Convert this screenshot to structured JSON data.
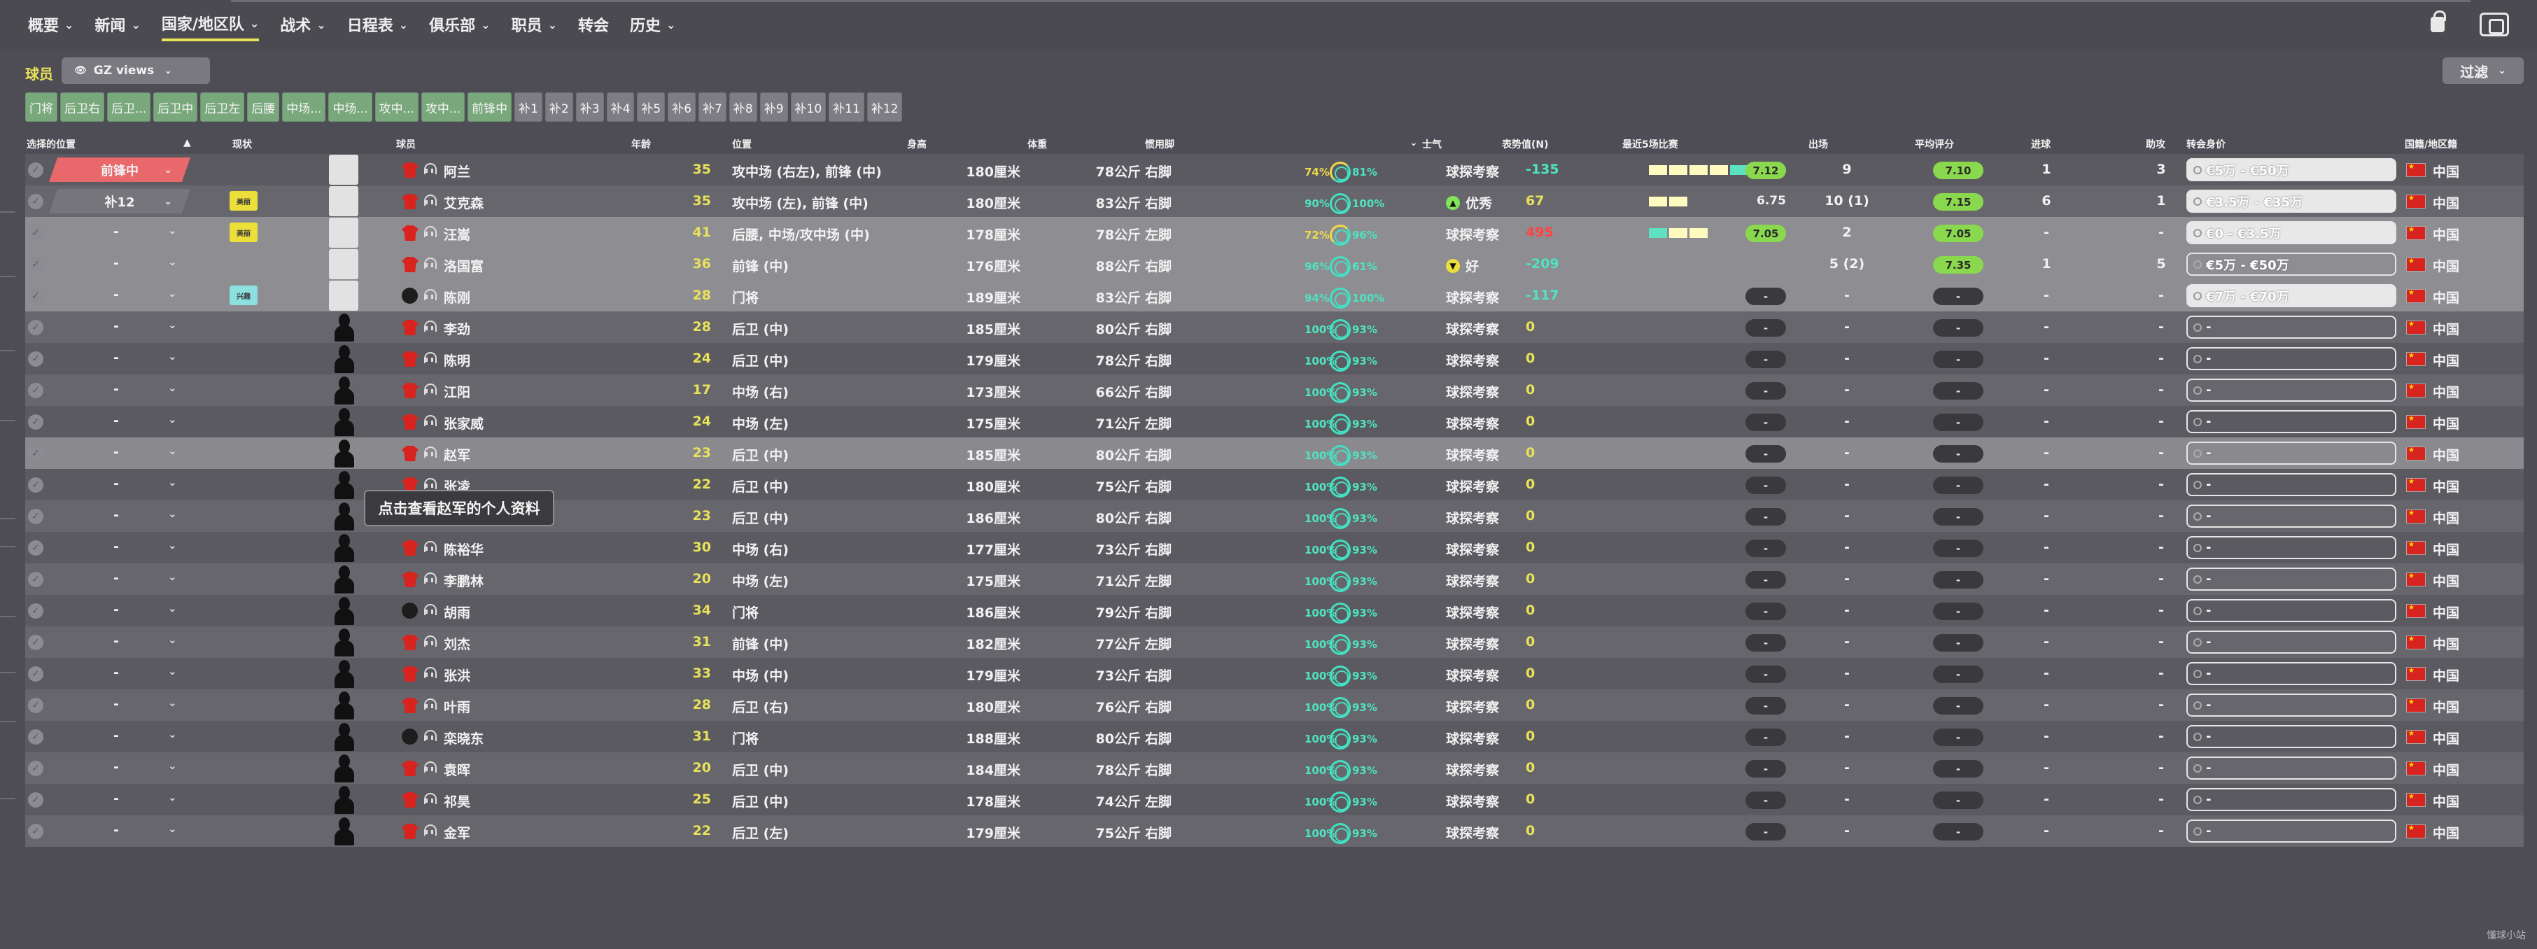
{
  "nav": {
    "items": [
      {
        "label": "概要",
        "chevron": true
      },
      {
        "label": "新闻",
        "chevron": true
      },
      {
        "label": "国家/地区队",
        "chevron": true,
        "active": true
      },
      {
        "label": "战术",
        "chevron": true
      },
      {
        "label": "日程表",
        "chevron": true
      },
      {
        "label": "俱乐部",
        "chevron": true
      },
      {
        "label": "职员",
        "chevron": true
      },
      {
        "label": "转会",
        "chevron": false
      },
      {
        "label": "历史",
        "chevron": true
      }
    ]
  },
  "section": {
    "label": "球员",
    "views_label": "GZ views",
    "filter_label": "过滤"
  },
  "chips": [
    "门将",
    "后卫右",
    "后卫...",
    "后卫中",
    "后卫左",
    "后腰",
    "中场...",
    "中场...",
    "攻中...",
    "攻中...",
    "前锋中",
    "补1",
    "补2",
    "补3",
    "补4",
    "补5",
    "补6",
    "补7",
    "补8",
    "补9",
    "补10",
    "补11",
    "补12"
  ],
  "columns": {
    "selected_position": "选择的位置",
    "status": "现状",
    "player": "球员",
    "age": "年龄",
    "position": "位置",
    "height": "身高",
    "weight": "体重",
    "foot": "惯用脚",
    "morale": "士气",
    "sell": "表势值(N)",
    "form": "最近5场比赛",
    "apps": "出场",
    "avg": "平均评分",
    "goals": "进球",
    "assists": "助攻",
    "value": "转会身价",
    "nation": "国籍/地区籍"
  },
  "tooltip": "点击查看赵军的个人资料",
  "watermark": "懂球小站",
  "players": [
    {
      "sel": "前锋中",
      "sel_style": "red",
      "status": "",
      "avatar": "photo",
      "kit": "shirt",
      "name": "阿兰",
      "age": "35",
      "position": "攻中场 (右左), 前锋 (中)",
      "height": "180厘米",
      "weight": "78公斤",
      "foot": "右脚",
      "c1": "74%",
      "c2": "81%",
      "cy": true,
      "morale": "球探考察",
      "micon": "",
      "sell": "-135",
      "sellc": "g",
      "form": [
        "y",
        "y",
        "y",
        "y",
        "t"
      ],
      "rating": "7.12",
      "rstyle": "g",
      "apps": "9",
      "avg": "7.10",
      "avgstyle": "g",
      "goals": "1",
      "assists": "3",
      "value": "€5万 - €50万",
      "vfill": true,
      "nation": "中国"
    },
    {
      "sel": "补12",
      "sel_style": "gray",
      "status": "美丽",
      "avatar": "photo",
      "kit": "shirt",
      "name": "艾克森",
      "age": "35",
      "position": "攻中场 (左), 前锋 (中)",
      "height": "180厘米",
      "weight": "83公斤",
      "foot": "右脚",
      "c1": "90%",
      "c2": "100%",
      "cy": false,
      "morale": "优秀",
      "micon": "g",
      "sell": "67",
      "sellc": "y",
      "form": [
        "y",
        "y"
      ],
      "rating": "6.75",
      "rstyle": "t",
      "apps": "10 (1)",
      "avg": "7.15",
      "avgstyle": "g",
      "goals": "6",
      "assists": "1",
      "value": "€3.5万 - €35万",
      "vfill": true,
      "nation": "中国"
    },
    {
      "sel": "-",
      "sel_style": "",
      "status": "美丽",
      "avatar": "photo",
      "kit": "shirt",
      "name": "汪嵩",
      "age": "41",
      "position": "后腰, 中场/攻中场 (中)",
      "height": "178厘米",
      "weight": "78公斤",
      "foot": "左脚",
      "c1": "72%",
      "c2": "96%",
      "cy": true,
      "morale": "球探考察",
      "micon": "",
      "sell": "495",
      "sellc": "r",
      "form": [
        "t",
        "y",
        "y"
      ],
      "rating": "7.05",
      "rstyle": "g",
      "apps": "2",
      "avg": "7.05",
      "avgstyle": "g",
      "goals": "-",
      "assists": "-",
      "value": "€0 - €3.5万",
      "vfill": true,
      "nation": "中国"
    },
    {
      "sel": "-",
      "sel_style": "",
      "status": "",
      "avatar": "photo",
      "kit": "shirt",
      "name": "洛国富",
      "age": "36",
      "position": "前锋 (中)",
      "height": "176厘米",
      "weight": "88公斤",
      "foot": "右脚",
      "c1": "96%",
      "c2": "61%",
      "cy": false,
      "morale": "好",
      "micon": "y",
      "sell": "-209",
      "sellc": "g",
      "form": [],
      "rating": "",
      "rstyle": "",
      "apps": "5 (2)",
      "avg": "7.35",
      "avgstyle": "g",
      "goals": "1",
      "assists": "5",
      "value": "€5万 - €50万",
      "vfill": false,
      "nation": "中国"
    },
    {
      "sel": "-",
      "sel_style": "",
      "status": "兴趣",
      "avatar": "photo",
      "kit": "ball",
      "name": "陈刚",
      "age": "28",
      "position": "门将",
      "height": "189厘米",
      "weight": "83公斤",
      "foot": "右脚",
      "c1": "94%",
      "c2": "100%",
      "cy": false,
      "morale": "球探考察",
      "micon": "",
      "sell": "-117",
      "sellc": "g",
      "form": [],
      "rating": "-",
      "rstyle": "n",
      "apps": "-",
      "avg": "-",
      "avgstyle": "n",
      "goals": "-",
      "assists": "-",
      "value": "€7万 - €70万",
      "vfill": true,
      "nation": "中国"
    },
    {
      "sel": "-",
      "sel_style": "",
      "status": "",
      "avatar": "sil",
      "kit": "shirt",
      "name": "李劲",
      "age": "28",
      "position": "后卫 (中)",
      "height": "185厘米",
      "weight": "80公斤",
      "foot": "右脚",
      "c1": "100%",
      "c2": "93%",
      "cy": false,
      "morale": "球探考察",
      "micon": "",
      "sell": "0",
      "sellc": "y",
      "form": [],
      "rating": "-",
      "rstyle": "n",
      "apps": "-",
      "avg": "-",
      "avgstyle": "n",
      "goals": "-",
      "assists": "-",
      "value": "-",
      "vfill": false,
      "nation": "中国"
    },
    {
      "sel": "-",
      "sel_style": "",
      "status": "",
      "avatar": "sil",
      "kit": "shirt",
      "name": "陈明",
      "age": "24",
      "position": "后卫 (中)",
      "height": "179厘米",
      "weight": "78公斤",
      "foot": "右脚",
      "c1": "100%",
      "c2": "93%",
      "cy": false,
      "morale": "球探考察",
      "micon": "",
      "sell": "0",
      "sellc": "y",
      "form": [],
      "rating": "-",
      "rstyle": "n",
      "apps": "-",
      "avg": "-",
      "avgstyle": "n",
      "goals": "-",
      "assists": "-",
      "value": "-",
      "vfill": false,
      "nation": "中国"
    },
    {
      "sel": "-",
      "sel_style": "",
      "status": "",
      "avatar": "sil",
      "kit": "shirt",
      "name": "江阳",
      "age": "17",
      "position": "中场 (右)",
      "height": "173厘米",
      "weight": "66公斤",
      "foot": "右脚",
      "c1": "100%",
      "c2": "93%",
      "cy": false,
      "morale": "球探考察",
      "micon": "",
      "sell": "0",
      "sellc": "y",
      "form": [],
      "rating": "-",
      "rstyle": "n",
      "apps": "-",
      "avg": "-",
      "avgstyle": "n",
      "goals": "-",
      "assists": "-",
      "value": "-",
      "vfill": false,
      "nation": "中国"
    },
    {
      "sel": "-",
      "sel_style": "",
      "status": "",
      "avatar": "sil",
      "kit": "shirt",
      "name": "张家威",
      "age": "24",
      "position": "中场 (左)",
      "height": "175厘米",
      "weight": "71公斤",
      "foot": "左脚",
      "c1": "100%",
      "c2": "93%",
      "cy": false,
      "morale": "球探考察",
      "micon": "",
      "sell": "0",
      "sellc": "y",
      "form": [],
      "rating": "-",
      "rstyle": "n",
      "apps": "-",
      "avg": "-",
      "avgstyle": "n",
      "goals": "-",
      "assists": "-",
      "value": "-",
      "vfill": false,
      "nation": "中国"
    },
    {
      "sel": "-",
      "sel_style": "",
      "status": "",
      "avatar": "sil",
      "kit": "shirt",
      "name": "赵军",
      "age": "23",
      "position": "后卫 (中)",
      "height": "185厘米",
      "weight": "80公斤",
      "foot": "右脚",
      "c1": "100%",
      "c2": "93%",
      "cy": false,
      "morale": "球探考察",
      "micon": "",
      "sell": "0",
      "sellc": "y",
      "form": [],
      "rating": "-",
      "rstyle": "n",
      "apps": "-",
      "avg": "-",
      "avgstyle": "n",
      "goals": "-",
      "assists": "-",
      "value": "-",
      "vfill": false,
      "nation": "中国"
    },
    {
      "sel": "-",
      "sel_style": "",
      "status": "",
      "avatar": "sil",
      "kit": "shirt",
      "name": "张凌",
      "age": "22",
      "position": "后卫 (中)",
      "height": "180厘米",
      "weight": "75公斤",
      "foot": "右脚",
      "c1": "100%",
      "c2": "93%",
      "cy": false,
      "morale": "球探考察",
      "micon": "",
      "sell": "0",
      "sellc": "y",
      "form": [],
      "rating": "-",
      "rstyle": "n",
      "apps": "-",
      "avg": "-",
      "avgstyle": "n",
      "goals": "-",
      "assists": "-",
      "value": "-",
      "vfill": false,
      "nation": "中国"
    },
    {
      "sel": "-",
      "sel_style": "",
      "status": "",
      "avatar": "sil",
      "kit": "shirt",
      "name": "",
      "age": "23",
      "position": "后卫 (中)",
      "height": "186厘米",
      "weight": "80公斤",
      "foot": "右脚",
      "c1": "100%",
      "c2": "93%",
      "cy": false,
      "morale": "球探考察",
      "micon": "",
      "sell": "0",
      "sellc": "y",
      "form": [],
      "rating": "-",
      "rstyle": "n",
      "apps": "-",
      "avg": "-",
      "avgstyle": "n",
      "goals": "-",
      "assists": "-",
      "value": "-",
      "vfill": false,
      "nation": "中国"
    },
    {
      "sel": "-",
      "sel_style": "",
      "status": "",
      "avatar": "sil",
      "kit": "shirt",
      "name": "陈裕华",
      "age": "30",
      "position": "中场 (右)",
      "height": "177厘米",
      "weight": "73公斤",
      "foot": "右脚",
      "c1": "100%",
      "c2": "93%",
      "cy": false,
      "morale": "球探考察",
      "micon": "",
      "sell": "0",
      "sellc": "y",
      "form": [],
      "rating": "-",
      "rstyle": "n",
      "apps": "-",
      "avg": "-",
      "avgstyle": "n",
      "goals": "-",
      "assists": "-",
      "value": "-",
      "vfill": false,
      "nation": "中国"
    },
    {
      "sel": "-",
      "sel_style": "",
      "status": "",
      "avatar": "sil",
      "kit": "shirt",
      "name": "李鹏林",
      "age": "20",
      "position": "中场 (左)",
      "height": "175厘米",
      "weight": "71公斤",
      "foot": "左脚",
      "c1": "100%",
      "c2": "93%",
      "cy": false,
      "morale": "球探考察",
      "micon": "",
      "sell": "0",
      "sellc": "y",
      "form": [],
      "rating": "-",
      "rstyle": "n",
      "apps": "-",
      "avg": "-",
      "avgstyle": "n",
      "goals": "-",
      "assists": "-",
      "value": "-",
      "vfill": false,
      "nation": "中国"
    },
    {
      "sel": "-",
      "sel_style": "",
      "status": "",
      "avatar": "sil",
      "kit": "ball",
      "name": "胡雨",
      "age": "34",
      "position": "门将",
      "height": "186厘米",
      "weight": "79公斤",
      "foot": "右脚",
      "c1": "100%",
      "c2": "93%",
      "cy": false,
      "morale": "球探考察",
      "micon": "",
      "sell": "0",
      "sellc": "y",
      "form": [],
      "rating": "-",
      "rstyle": "n",
      "apps": "-",
      "avg": "-",
      "avgstyle": "n",
      "goals": "-",
      "assists": "-",
      "value": "-",
      "vfill": false,
      "nation": "中国"
    },
    {
      "sel": "-",
      "sel_style": "",
      "status": "",
      "avatar": "sil",
      "kit": "shirt",
      "name": "刘杰",
      "age": "31",
      "position": "前锋 (中)",
      "height": "182厘米",
      "weight": "77公斤",
      "foot": "左脚",
      "c1": "100%",
      "c2": "93%",
      "cy": false,
      "morale": "球探考察",
      "micon": "",
      "sell": "0",
      "sellc": "y",
      "form": [],
      "rating": "-",
      "rstyle": "n",
      "apps": "-",
      "avg": "-",
      "avgstyle": "n",
      "goals": "-",
      "assists": "-",
      "value": "-",
      "vfill": false,
      "nation": "中国"
    },
    {
      "sel": "-",
      "sel_style": "",
      "status": "",
      "avatar": "sil",
      "kit": "shirt",
      "name": "张洪",
      "age": "33",
      "position": "中场 (中)",
      "height": "179厘米",
      "weight": "73公斤",
      "foot": "右脚",
      "c1": "100%",
      "c2": "93%",
      "cy": false,
      "morale": "球探考察",
      "micon": "",
      "sell": "0",
      "sellc": "y",
      "form": [],
      "rating": "-",
      "rstyle": "n",
      "apps": "-",
      "avg": "-",
      "avgstyle": "n",
      "goals": "-",
      "assists": "-",
      "value": "-",
      "vfill": false,
      "nation": "中国"
    },
    {
      "sel": "-",
      "sel_style": "",
      "status": "",
      "avatar": "sil",
      "kit": "shirt",
      "name": "叶雨",
      "age": "28",
      "position": "后卫 (右)",
      "height": "180厘米",
      "weight": "76公斤",
      "foot": "右脚",
      "c1": "100%",
      "c2": "93%",
      "cy": false,
      "morale": "球探考察",
      "micon": "",
      "sell": "0",
      "sellc": "y",
      "form": [],
      "rating": "-",
      "rstyle": "n",
      "apps": "-",
      "avg": "-",
      "avgstyle": "n",
      "goals": "-",
      "assists": "-",
      "value": "-",
      "vfill": false,
      "nation": "中国"
    },
    {
      "sel": "-",
      "sel_style": "",
      "status": "",
      "avatar": "sil",
      "kit": "ball",
      "name": "栾晓东",
      "age": "31",
      "position": "门将",
      "height": "188厘米",
      "weight": "80公斤",
      "foot": "右脚",
      "c1": "100%",
      "c2": "93%",
      "cy": false,
      "morale": "球探考察",
      "micon": "",
      "sell": "0",
      "sellc": "y",
      "form": [],
      "rating": "-",
      "rstyle": "n",
      "apps": "-",
      "avg": "-",
      "avgstyle": "n",
      "goals": "-",
      "assists": "-",
      "value": "-",
      "vfill": false,
      "nation": "中国"
    },
    {
      "sel": "-",
      "sel_style": "",
      "status": "",
      "avatar": "sil",
      "kit": "shirt",
      "name": "袁晖",
      "age": "20",
      "position": "后卫 (中)",
      "height": "184厘米",
      "weight": "78公斤",
      "foot": "右脚",
      "c1": "100%",
      "c2": "93%",
      "cy": false,
      "morale": "球探考察",
      "micon": "",
      "sell": "0",
      "sellc": "y",
      "form": [],
      "rating": "-",
      "rstyle": "n",
      "apps": "-",
      "avg": "-",
      "avgstyle": "n",
      "goals": "-",
      "assists": "-",
      "value": "-",
      "vfill": false,
      "nation": "中国"
    },
    {
      "sel": "-",
      "sel_style": "",
      "status": "",
      "avatar": "sil",
      "kit": "shirt",
      "name": "祁昊",
      "age": "25",
      "position": "后卫 (中)",
      "height": "178厘米",
      "weight": "74公斤",
      "foot": "左脚",
      "c1": "100%",
      "c2": "93%",
      "cy": false,
      "morale": "球探考察",
      "micon": "",
      "sell": "0",
      "sellc": "y",
      "form": [],
      "rating": "-",
      "rstyle": "n",
      "apps": "-",
      "avg": "-",
      "avgstyle": "n",
      "goals": "-",
      "assists": "-",
      "value": "-",
      "vfill": false,
      "nation": "中国"
    },
    {
      "sel": "-",
      "sel_style": "",
      "status": "",
      "avatar": "sil",
      "kit": "shirt",
      "name": "金军",
      "age": "22",
      "position": "后卫 (左)",
      "height": "179厘米",
      "weight": "75公斤",
      "foot": "右脚",
      "c1": "100%",
      "c2": "93%",
      "cy": false,
      "morale": "球探考察",
      "micon": "",
      "sell": "0",
      "sellc": "y",
      "form": [],
      "rating": "-",
      "rstyle": "n",
      "apps": "-",
      "avg": "-",
      "avgstyle": "n",
      "goals": "-",
      "assists": "-",
      "value": "-",
      "vfill": false,
      "nation": "中国"
    }
  ]
}
